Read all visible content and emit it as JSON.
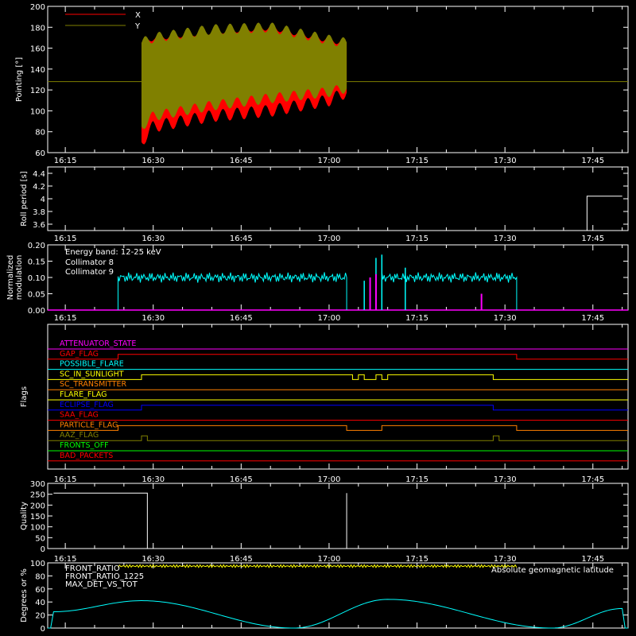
{
  "chart_data": [
    {
      "id": "pointing",
      "type": "line",
      "ylabel": "Pointing [°]",
      "ylim": [
        60,
        200
      ],
      "yticks": [
        60,
        80,
        100,
        120,
        140,
        160,
        180,
        200
      ],
      "xticks": [
        "16:15",
        "16:30",
        "16:45",
        "17:00",
        "17:15",
        "17:30",
        "17:45"
      ],
      "legend": [
        "X",
        "Y"
      ],
      "legend_position": "top-left",
      "colors": {
        "X": "#ff0000",
        "Y": "#808000"
      },
      "baseline": 128,
      "series": [
        {
          "name": "X",
          "x": [
            "16:28",
            "16:30",
            "16:40",
            "16:50",
            "17:00",
            "17:03"
          ],
          "upper": [
            165,
            170,
            176,
            180,
            168,
            165
          ],
          "lower": [
            70,
            85,
            95,
            100,
            110,
            118
          ]
        },
        {
          "name": "Y",
          "x": [
            "16:28",
            "16:30",
            "16:40",
            "16:50",
            "17:00",
            "17:03"
          ],
          "upper": [
            165,
            170,
            178,
            180,
            168,
            165
          ],
          "lower": [
            85,
            95,
            105,
            112,
            118,
            122
          ]
        }
      ]
    },
    {
      "id": "roll",
      "type": "line",
      "ylabel": "Roll period [s]",
      "ylim": [
        3.5,
        4.5
      ],
      "yticks": [
        3.6,
        3.8,
        4.0,
        4.2,
        4.4
      ],
      "xticks": [
        "16:15",
        "16:30",
        "16:45",
        "17:00",
        "17:15",
        "17:30",
        "17:45"
      ],
      "series": [
        {
          "name": "roll",
          "x": [
            "17:44",
            "17:44",
            "17:50"
          ],
          "y": [
            3.5,
            4.04,
            4.04
          ]
        }
      ]
    },
    {
      "id": "modulation",
      "type": "line",
      "ylabel": "Normalized modulation",
      "ylim": [
        0,
        0.2
      ],
      "yticks": [
        "0.00",
        "0.05",
        "0.10",
        "0.15",
        "0.20"
      ],
      "xticks": [
        "16:15",
        "16:30",
        "16:45",
        "17:00",
        "17:15",
        "17:30",
        "17:45"
      ],
      "annotation": "Energy band: 12-25 keV",
      "legend": [
        "Collimator 8",
        "Collimator 9"
      ],
      "colors": {
        "Collimator 8": "#00ffff",
        "Collimator 9": "#ff00ff"
      },
      "series": [
        {
          "name": "Collimator 8",
          "segments": [
            [
              "16:24",
              "17:03"
            ],
            [
              "17:09",
              "17:32"
            ]
          ],
          "level": 0.1,
          "spikes": [
            [
              "17:06",
              0.09
            ],
            [
              "17:08",
              0.16
            ],
            [
              "17:09",
              0.17
            ],
            [
              "17:13",
              0.13
            ]
          ]
        },
        {
          "name": "Collimator 9",
          "spikes": [
            [
              "17:07",
              0.1
            ],
            [
              "17:08",
              0.11
            ],
            [
              "17:26",
              0.05
            ]
          ]
        }
      ]
    },
    {
      "id": "flags",
      "type": "line",
      "ylabel": "Flags",
      "xticks": [
        "16:15",
        "16:30",
        "16:45",
        "17:00",
        "17:15",
        "17:30",
        "17:45"
      ],
      "flags": [
        {
          "name": "ATTENUATOR_STATE",
          "color": "#ff00ff",
          "high": []
        },
        {
          "name": "GAP_FLAG",
          "color": "#ff0000",
          "high": [
            [
              "16:24",
              "17:32"
            ]
          ],
          "inverted": true
        },
        {
          "name": "POSSIBLE_FLARE",
          "color": "#00ffff",
          "high": []
        },
        {
          "name": "SC_IN_SUNLIGHT",
          "color": "#ffff00",
          "high": [
            [
              "16:28",
              "17:04"
            ],
            [
              "17:05",
              "17:06"
            ],
            [
              "17:08",
              "17:09"
            ],
            [
              "17:10",
              "17:28"
            ]
          ]
        },
        {
          "name": "SC_TRANSMITTER",
          "color": "#ff8000",
          "high": []
        },
        {
          "name": "FLARE_FLAG",
          "color": "#ffff00",
          "high": []
        },
        {
          "name": "ECLIPSE_FLAG",
          "color": "#0000ff",
          "high": [
            [
              "16:28",
              "17:28"
            ]
          ],
          "inverted": true
        },
        {
          "name": "SAA_FLAG",
          "color": "#ff0000",
          "high": []
        },
        {
          "name": "PARTICLE_FLAG",
          "color": "#ff8000",
          "high": [
            [
              "16:24",
              "17:03"
            ],
            [
              "17:09",
              "17:32"
            ]
          ]
        },
        {
          "name": "AAZ_FLAG",
          "color": "#808000",
          "high": [
            [
              "16:28",
              "16:29"
            ],
            [
              "17:28",
              "17:29"
            ]
          ]
        },
        {
          "name": "FRONTS_OFF",
          "color": "#00ff00",
          "high": []
        },
        {
          "name": "BAD_PACKETS",
          "color": "#ff0000",
          "high": []
        }
      ]
    },
    {
      "id": "quality",
      "type": "line",
      "ylabel": "Quality",
      "ylim": [
        0,
        300
      ],
      "yticks": [
        0,
        50,
        100,
        150,
        200,
        250,
        300
      ],
      "xticks": [
        "16:15",
        "16:30",
        "16:45",
        "17:00",
        "17:15",
        "17:30",
        "17:45"
      ],
      "series": [
        {
          "name": "quality",
          "x": [
            "16:13",
            "16:29",
            "16:29",
            "17:03",
            "17:03",
            "17:03",
            "17:50"
          ],
          "y": [
            255,
            255,
            0,
            0,
            255,
            0,
            0
          ]
        }
      ]
    },
    {
      "id": "ratios",
      "type": "line",
      "ylabel": "Degrees or %",
      "ylim": [
        0,
        100
      ],
      "yticks": [
        0,
        20,
        40,
        60,
        80,
        100
      ],
      "xticks": [
        "16:15",
        "16:30",
        "16:45",
        "17:00",
        "17:15",
        "17:30",
        "17:45"
      ],
      "legend": [
        "FRONT_RATIO",
        "FRONT_RATIO_1225",
        "MAX_DET_VS_TOT",
        "Absolute geomagnetic latitude"
      ],
      "colors": {
        "FRONT_RATIO": "#ffff00",
        "FRONT_RATIO_1225": "#00ff00",
        "MAX_DET_VS_TOT": "#ff8000",
        "Absolute geomagnetic latitude": "#00ffff"
      },
      "series": [
        {
          "name": "FRONT_RATIO",
          "x": [
            "16:24",
            "17:32"
          ],
          "y": [
            95,
            95
          ]
        },
        {
          "name": "Absolute geomagnetic latitude",
          "x": [
            "16:13",
            "16:28",
            "16:54",
            "17:10",
            "17:38",
            "17:50"
          ],
          "y": [
            25,
            42,
            0,
            44,
            0,
            30
          ]
        }
      ]
    }
  ]
}
